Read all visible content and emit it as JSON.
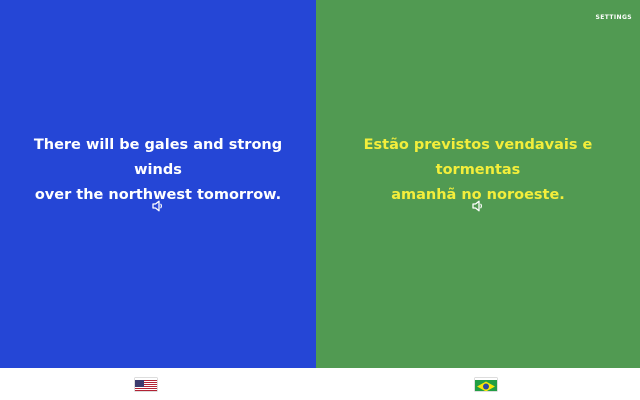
{
  "colors": {
    "left_bg": "#2546d6",
    "right_bg": "#519a52",
    "source_text": "#ffffff",
    "target_text": "#f3ee3b",
    "settings_text": "#ffffff"
  },
  "source": {
    "language": "English",
    "line1": "There will be gales and strong winds",
    "line2": "over the northwest tomorrow.",
    "speaker_icon": "speaker-icon"
  },
  "target": {
    "language": "Portuguese",
    "line1": "Estão previstos vendavais e tormentas",
    "line2": "amanhã no noroeste.",
    "speaker_icon": "speaker-icon"
  },
  "header": {
    "settings_label": "SETTINGS"
  },
  "footer": {
    "flags": [
      "us-flag-icon",
      "brazil-flag-icon"
    ]
  }
}
